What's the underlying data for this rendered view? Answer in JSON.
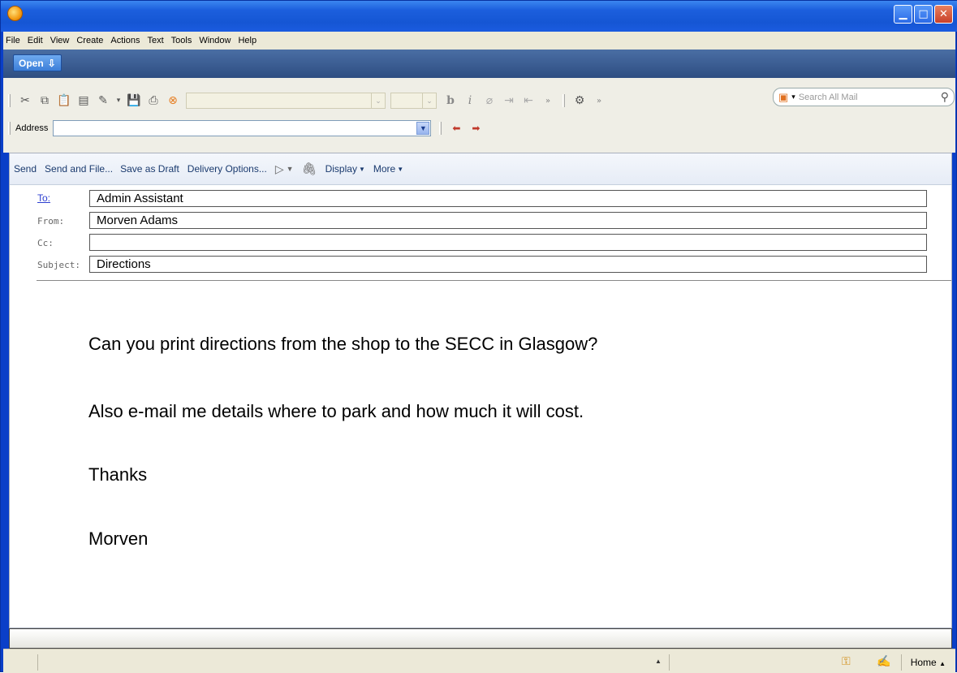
{
  "window": {
    "title": "",
    "controls": [
      "minimize",
      "maximize",
      "close"
    ]
  },
  "menu": {
    "items": [
      "File",
      "Edit",
      "View",
      "Create",
      "Actions",
      "Text",
      "Tools",
      "Window",
      "Help"
    ]
  },
  "open_bar": {
    "label": "Open"
  },
  "toolbar": {
    "search_placeholder": "Search All Mail",
    "address_label": "Address",
    "address_value": ""
  },
  "actions": {
    "send": "Send",
    "send_and_file": "Send and File...",
    "save_as_draft": "Save as Draft",
    "delivery_options": "Delivery Options...",
    "display": "Display",
    "more": "More"
  },
  "header": {
    "to_label": "To:",
    "to_value": "Admin Assistant",
    "from_label": "From:",
    "from_value": "Morven Adams",
    "cc_label": "Cc:",
    "cc_value": "",
    "subject_label": "Subject:",
    "subject_value": "Directions"
  },
  "body": {
    "lines": [
      "Can you print directions from the shop to the SECC in Glasgow?",
      "Also e-mail me details where to park and how much it will cost.",
      "Thanks",
      "Morven"
    ]
  },
  "status": {
    "home": "Home"
  }
}
